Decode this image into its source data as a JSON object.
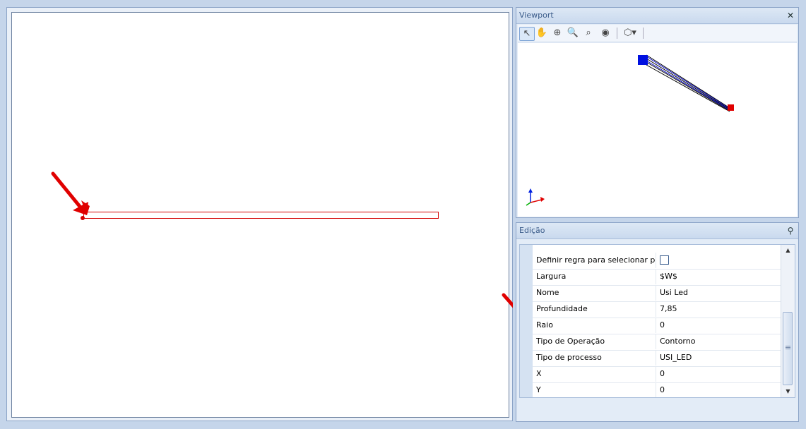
{
  "viewport": {
    "title": "Viewport",
    "close_icon": "✕",
    "toolbar": [
      {
        "icon": "pointer-select-icon",
        "glyph": "↖"
      },
      {
        "icon": "pan-hand-icon",
        "glyph": "✋"
      },
      {
        "icon": "zoom-plus-icon",
        "glyph": "⊕"
      },
      {
        "icon": "zoom-window-icon",
        "glyph": "🔍"
      },
      {
        "icon": "zoom-extents-icon",
        "glyph": "⌕"
      },
      {
        "icon": "orbit-eye-icon",
        "glyph": "◉"
      },
      {
        "icon": "view-cube-dropdown-icon",
        "glyph": "⬡▾"
      }
    ]
  },
  "edit": {
    "title": "Edição",
    "pin_icon": "📌",
    "rows": [
      {
        "name": "Definir regra para selecionar pro...",
        "value": "",
        "checkbox": true
      },
      {
        "name": "Largura",
        "value": "$W$"
      },
      {
        "name": "Nome",
        "value": "Usi Led"
      },
      {
        "name": "Profundidade",
        "value": "7,85"
      },
      {
        "name": "Raio",
        "value": "0"
      },
      {
        "name": "Tipo de Operação",
        "value": "Contorno"
      },
      {
        "name": "Tipo de processo",
        "value": "USI_LED"
      },
      {
        "name": "X",
        "value": "0"
      },
      {
        "name": "Y",
        "value": "0"
      }
    ]
  },
  "colors": {
    "accent": "#d40000",
    "viewport_start": "#0010e0",
    "viewport_end": "#e00000"
  }
}
